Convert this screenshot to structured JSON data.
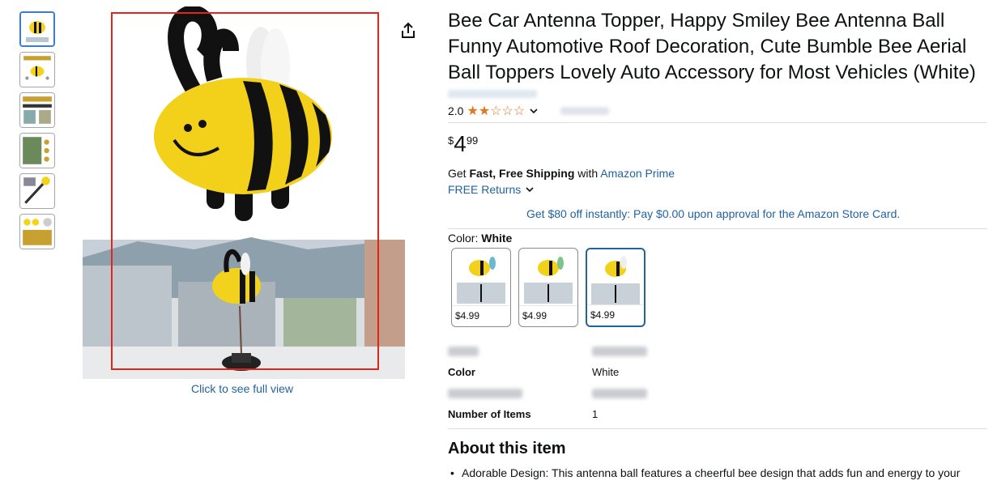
{
  "product": {
    "title": "Bee Car Antenna Topper, Happy Smiley Bee Antenna Ball Funny Automotive Roof Decoration, Cute Bumble Bee Aerial Ball Toppers Lovely Auto Accessory for Most Vehicles (White)",
    "rating_value": "2.0",
    "rating_stars": "★★☆☆☆",
    "price_symbol": "$",
    "price_whole": "4",
    "price_fraction": "99"
  },
  "shipping": {
    "get": "Get ",
    "fast_free": "Fast, Free Shipping",
    "with": " with ",
    "prime": "Amazon Prime",
    "returns": "FREE Returns"
  },
  "promo": "Get $80 off instantly: Pay $0.00 upon approval for the Amazon Store Card.",
  "variant": {
    "label": "Color: ",
    "selected": "White",
    "swatches": [
      {
        "price": "$4.99"
      },
      {
        "price": "$4.99"
      },
      {
        "price": "$4.99"
      }
    ]
  },
  "specs": {
    "color_key": "Color",
    "color_val": "White",
    "items_key": "Number of Items",
    "items_val": "1"
  },
  "gallery": {
    "full_view": "Click to see full view"
  },
  "about": {
    "heading": "About this item",
    "bullet1": "Adorable Design: This antenna ball features a cheerful bee design that adds fun and energy to your"
  },
  "icons": {
    "share": "share-icon",
    "chevron": "chevron-down-icon"
  },
  "colors": {
    "link": "#2162a1",
    "star": "#de7921",
    "highlight_box": "#e3241b",
    "selected_border": "#3b7bd5"
  }
}
